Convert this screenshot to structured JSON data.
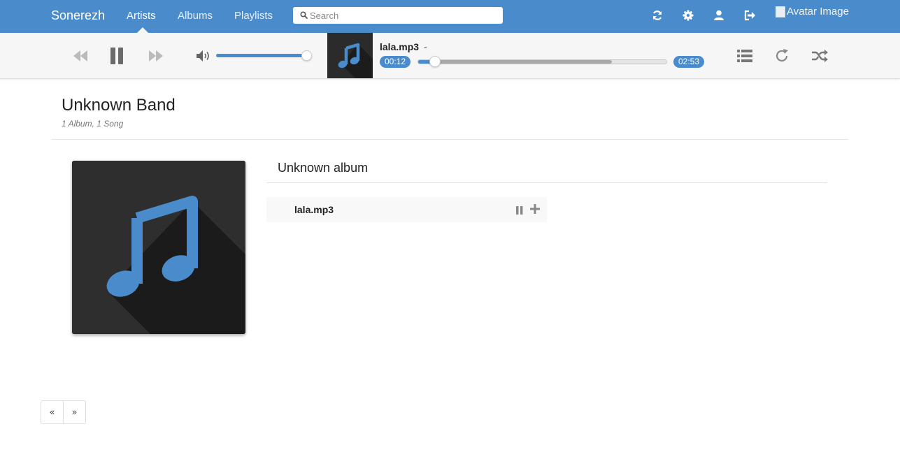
{
  "navbar": {
    "brand": "Sonerezh",
    "links": [
      {
        "label": "Artists",
        "active": true
      },
      {
        "label": "Albums",
        "active": false
      },
      {
        "label": "Playlists",
        "active": false
      }
    ],
    "search_placeholder": "Search",
    "icons": [
      "sync-icon",
      "gear-icon",
      "user-icon",
      "logout-icon"
    ],
    "avatar_alt": "Avatar Image"
  },
  "player": {
    "track_title": "lala.mp3",
    "artist_separator": "-",
    "current_time": "00:12",
    "total_time": "02:53",
    "progress_fraction": 0.07,
    "buffered_fraction": 0.78,
    "volume_fraction": 0.95,
    "state": "playing"
  },
  "artist": {
    "name": "Unknown Band",
    "meta": "1 Album, 1 Song"
  },
  "album": {
    "title": "Unknown album",
    "tracks": [
      {
        "title": "lala.mp3"
      }
    ]
  },
  "pagination": {
    "prev": "«",
    "next": "»"
  },
  "colors": {
    "accent": "#4a8ccb",
    "navbar": "#4a8ccb",
    "player_bg": "#f6f6f6"
  }
}
